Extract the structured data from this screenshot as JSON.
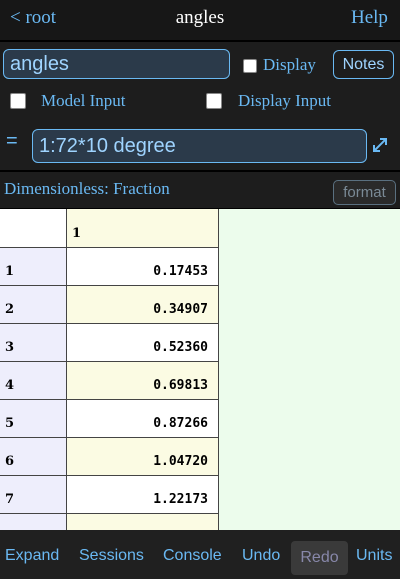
{
  "nav": {
    "back_label": "< root",
    "title": "angles",
    "help_label": "Help"
  },
  "editor": {
    "name_value": "angles",
    "display_label": "Display",
    "display_checked": false,
    "notes_label": "Notes",
    "model_input_label": "Model Input",
    "model_input_checked": false,
    "display_input_label": "Display Input",
    "display_input_checked": false,
    "equals_sign": "=",
    "formula_value": "1:72*10 degree",
    "expand_icon": "expand-arrows-icon"
  },
  "unit": {
    "label": "Dimensionless: Fraction",
    "format_label": "format"
  },
  "table": {
    "column_header": "1",
    "rows": [
      {
        "label": "1",
        "value": "0.17453"
      },
      {
        "label": "2",
        "value": "0.34907"
      },
      {
        "label": "3",
        "value": "0.52360"
      },
      {
        "label": "4",
        "value": "0.69813"
      },
      {
        "label": "5",
        "value": "0.87266"
      },
      {
        "label": "6",
        "value": "1.04720"
      },
      {
        "label": "7",
        "value": "1.22173"
      }
    ]
  },
  "toolbar": {
    "expand_label": "Expand",
    "sessions_label": "Sessions",
    "console_label": "Console",
    "undo_label": "Undo",
    "redo_label": "Redo",
    "units_label": "Units"
  },
  "colors": {
    "accent": "#6ab9f3",
    "panel": "#1d1d1d",
    "input_bg": "#2b3a4a",
    "table_bg": "#ecfcec",
    "col_alt": "#fbfbe3",
    "row_head": "#eeeefc"
  }
}
